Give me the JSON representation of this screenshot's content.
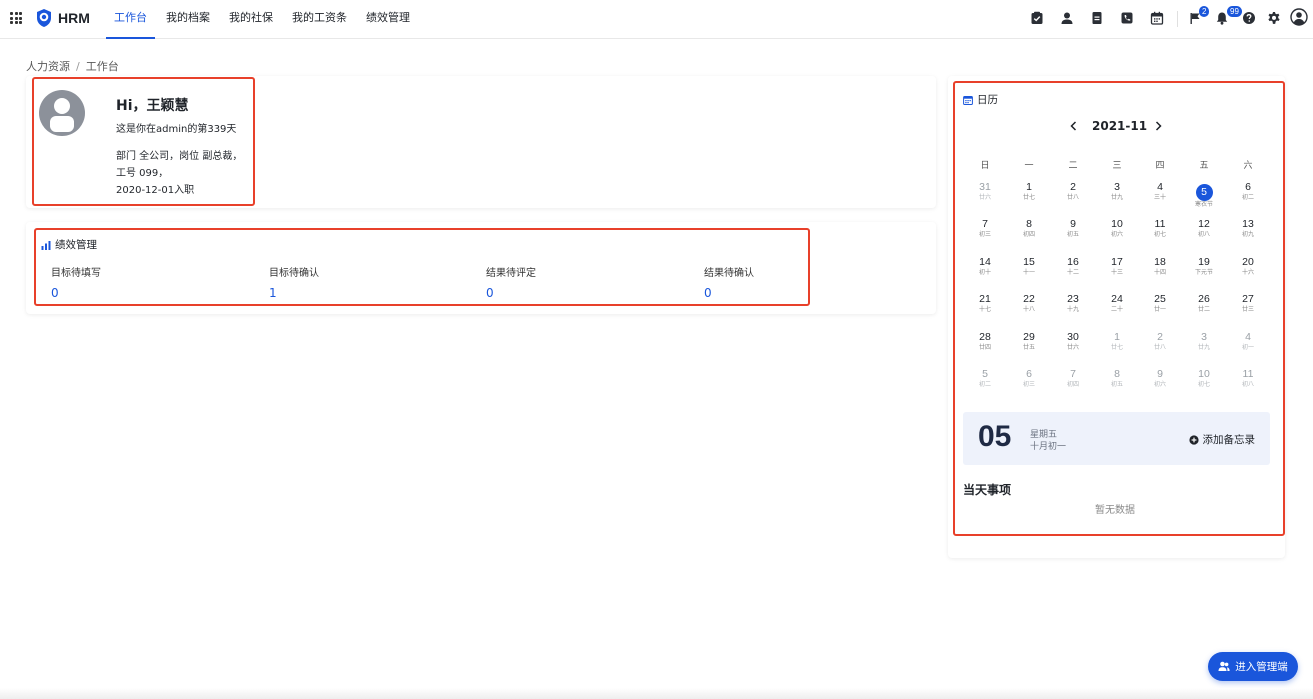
{
  "app": {
    "name": "HRM"
  },
  "nav": {
    "items": [
      {
        "label": "工作台",
        "active": true
      },
      {
        "label": "我的档案",
        "active": false
      },
      {
        "label": "我的社保",
        "active": false
      },
      {
        "label": "我的工资条",
        "active": false
      },
      {
        "label": "绩效管理",
        "active": false
      }
    ]
  },
  "header_icons": [
    "task-check-icon",
    "user-icon",
    "document-icon",
    "phone-icon",
    "calendar-icon",
    "flag-icon",
    "bell-icon",
    "help-icon",
    "settings-icon",
    "account-avatar-icon"
  ],
  "badges": {
    "flag": "2",
    "bell": "99"
  },
  "breadcrumb": {
    "root": "人力资源",
    "separator": "/",
    "current": "工作台"
  },
  "profile": {
    "greeting": "Hi，王颖慧",
    "days_line": "这是你在admin的第339天",
    "dept_line": "部门 全公司，岗位 副总裁，",
    "emp_no_line": "工号 099，",
    "joined_line": "2020-12-01入职"
  },
  "performance": {
    "title": "绩效管理",
    "items": [
      {
        "label": "目标待填写",
        "value": "0"
      },
      {
        "label": "目标待确认",
        "value": "1"
      },
      {
        "label": "结果待评定",
        "value": "0"
      },
      {
        "label": "结果待确认",
        "value": "0"
      }
    ]
  },
  "calendar": {
    "title": "日历",
    "month": "2021-11",
    "weekdays": [
      "日",
      "一",
      "二",
      "三",
      "四",
      "五",
      "六"
    ],
    "weeks": [
      [
        [
          "31",
          "廿六",
          1
        ],
        [
          "1",
          "廿七",
          0
        ],
        [
          "2",
          "廿八",
          0
        ],
        [
          "3",
          "廿九",
          0
        ],
        [
          "4",
          "三十",
          0
        ],
        [
          "5",
          "寒衣节",
          2
        ],
        [
          "6",
          "初二",
          0
        ]
      ],
      [
        [
          "7",
          "初三",
          0
        ],
        [
          "8",
          "初四",
          0
        ],
        [
          "9",
          "初五",
          0
        ],
        [
          "10",
          "初六",
          0
        ],
        [
          "11",
          "初七",
          0
        ],
        [
          "12",
          "初八",
          0
        ],
        [
          "13",
          "初九",
          0
        ]
      ],
      [
        [
          "14",
          "初十",
          0
        ],
        [
          "15",
          "十一",
          0
        ],
        [
          "16",
          "十二",
          0
        ],
        [
          "17",
          "十三",
          0
        ],
        [
          "18",
          "十四",
          0
        ],
        [
          "19",
          "下元节",
          0
        ],
        [
          "20",
          "十六",
          0
        ]
      ],
      [
        [
          "21",
          "十七",
          0
        ],
        [
          "22",
          "十八",
          0
        ],
        [
          "23",
          "十九",
          0
        ],
        [
          "24",
          "二十",
          0
        ],
        [
          "25",
          "廿一",
          0
        ],
        [
          "26",
          "廿二",
          0
        ],
        [
          "27",
          "廿三",
          0
        ]
      ],
      [
        [
          "28",
          "廿四",
          0
        ],
        [
          "29",
          "廿五",
          0
        ],
        [
          "30",
          "廿六",
          0
        ],
        [
          "1",
          "廿七",
          1
        ],
        [
          "2",
          "廿八",
          1
        ],
        [
          "3",
          "廿九",
          1
        ],
        [
          "4",
          "初一",
          1
        ]
      ],
      [
        [
          "5",
          "初二",
          1
        ],
        [
          "6",
          "初三",
          1
        ],
        [
          "7",
          "初四",
          1
        ],
        [
          "8",
          "初五",
          1
        ],
        [
          "9",
          "初六",
          1
        ],
        [
          "10",
          "初七",
          1
        ],
        [
          "11",
          "初八",
          1
        ]
      ]
    ],
    "selected": {
      "day": "05",
      "weekday": "星期五",
      "lunar": "十月初一"
    },
    "add_memo": "添加备忘录",
    "today_title": "当天事项",
    "empty_text": "暂无数据"
  },
  "admin_button": "进入管理端",
  "colors": {
    "primary": "#1a56db",
    "highlight_box": "#e8402a"
  }
}
